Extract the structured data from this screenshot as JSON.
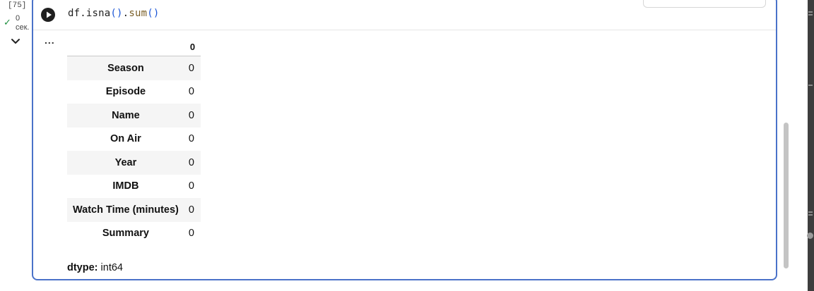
{
  "gutter": {
    "execution_count": "[75]",
    "execution_time_value": "0",
    "execution_time_unit": "сек.",
    "status_icon": "check-icon",
    "collapse_icon": "chevron-down-icon"
  },
  "cell": {
    "code_parts": {
      "obj": "df.",
      "method1": "isna",
      "parens1": "()",
      "dot": ".",
      "method2": "sum",
      "parens2": "()"
    },
    "output_menu_label": "...",
    "output": {
      "column_header": "0",
      "rows": [
        {
          "label": "Season",
          "value": "0"
        },
        {
          "label": "Episode",
          "value": "0"
        },
        {
          "label": "Name",
          "value": "0"
        },
        {
          "label": "On Air",
          "value": "0"
        },
        {
          "label": "Year",
          "value": "0"
        },
        {
          "label": "IMDB",
          "value": "0"
        },
        {
          "label": "Watch Time (minutes)",
          "value": "0"
        },
        {
          "label": "Summary",
          "value": "0"
        }
      ],
      "dtype_label": "dtype:",
      "dtype_value": "int64"
    }
  },
  "colors": {
    "cell_border": "#4a72c9",
    "success": "#1e8e3e",
    "paren": "#1a55d6",
    "function": "#795e26"
  }
}
